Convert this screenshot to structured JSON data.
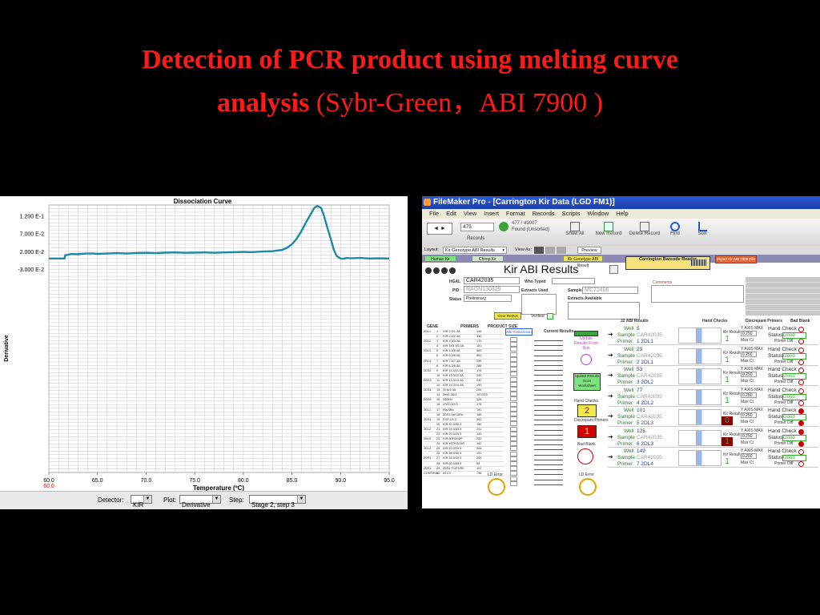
{
  "slide": {
    "title_bold_line1": "Detection of PCR product using melting curve",
    "title_bold_line2": "analysis",
    "title_rest": " (Sybr-Green，ABI 7900 )"
  },
  "chart_data": {
    "type": "line",
    "title": "Dissociation Curve",
    "xlabel": "Temperature (ºC)",
    "ylabel": "Derivative",
    "xlim": [
      60,
      95
    ],
    "ylim": [
      -0.6,
      0.15
    ],
    "x_ticks": [
      "60.0",
      "65.0",
      "70.0",
      "75.0",
      "80.0",
      "85.0",
      "90.0",
      "95.0"
    ],
    "x_tick_min_red": "60.0",
    "y_ticks": [
      "1.200 E-1",
      "7.000 E-2",
      "2.000 E-2",
      "-3.000 E-2"
    ],
    "grid": true,
    "line_color": "#1a8aa6",
    "series": [
      {
        "x": [
          60.0,
          61.6,
          61.7,
          61.8,
          62.0,
          62.3,
          63.0,
          63.5,
          64.0,
          64.5,
          65.0,
          66.0,
          67.0,
          68.0,
          69.0,
          70.0,
          71.0,
          72.0,
          73.0,
          74.0,
          75.0,
          76.0,
          77.0,
          78.0,
          79.0,
          80.0,
          81.0,
          82.0,
          83.0,
          84.0,
          84.5,
          85.0,
          85.5,
          86.0,
          86.5,
          87.0,
          87.3,
          87.6,
          88.0,
          88.3,
          88.6,
          89.0,
          89.3,
          89.6,
          90.0,
          90.3,
          90.6,
          91.0,
          92.0,
          93.0,
          94.0,
          95.0
        ],
        "values": [
          0.0,
          0.0,
          0.0095,
          0.0095,
          0.0105,
          0.0125,
          0.012,
          0.0135,
          0.014,
          0.014,
          0.013,
          0.014,
          0.015,
          0.014,
          0.0155,
          0.016,
          0.015,
          0.0165,
          0.017,
          0.016,
          0.0165,
          0.017,
          0.016,
          0.017,
          0.0175,
          0.0185,
          0.018,
          0.0195,
          0.0205,
          0.024,
          0.03,
          0.04,
          0.056,
          0.078,
          0.104,
          0.128,
          0.142,
          0.147,
          0.142,
          0.12,
          0.09,
          0.055,
          0.025,
          0.007,
          0.0,
          -0.001,
          0.0015,
          0.0005,
          0.0015,
          0.0,
          0.0005,
          0.0
        ]
      }
    ]
  },
  "controls": {
    "detector_label": "Detector:",
    "detector_value": "KIR",
    "plot_label": "Plot:",
    "plot_value": "Derivative",
    "step_label": "Step:",
    "step_value": "Stage 2, step 3"
  },
  "filemaker": {
    "window_title": "FileMaker Pro - [Carrington Kir Data (LGD FM1)]",
    "menu": [
      "File",
      "Edit",
      "View",
      "Insert",
      "Format",
      "Records",
      "Scripts",
      "Window",
      "Help"
    ],
    "record_number": "475",
    "found_line1": "477 / 49007",
    "found_line2": "Found (Unsorted)",
    "records_label": "Records",
    "toolbar_buttons": [
      "Show All",
      "New Record",
      "Delete Record",
      "Find",
      "Sort"
    ],
    "layout_label": "Layout:",
    "layout_value": "Kir Genotype ABI Results",
    "view_as_label": "View As:",
    "preview_label": "Preview",
    "tabs": [
      "Human Kir",
      "Chimp Kir",
      "Kir Genotype ABI Result"
    ],
    "heading": "Kir ABI Results",
    "barcode_button": "Carrington Barcode Reader",
    "import_button": "Import Kir ABI 7900 File",
    "hgal_label": "HGAL",
    "hgal_value": "CAR42035",
    "pid_label": "PID",
    "pid_value": "RAGN130329",
    "status_label": "Status",
    "status_value": "Preliminary",
    "who_typed_label": "Who Typed",
    "extracts_used_label": "Extracts Used",
    "sample_label": "Sample",
    "sample_value": "MC72406",
    "extracts_available_label": "Extracts Available",
    "comments_label": "Comments",
    "clear_button": "Clear ReDos",
    "verified_label": "Verified",
    "gene_headers": [
      "GENE",
      "PRIMERS",
      "PRODUCT SIZE"
    ],
    "abi_conversion": "ABI Conversion",
    "current_results": "Current Results",
    "update_results": "Update Results From Run",
    "update_results_scan": "Update Results Scan Worksheet",
    "results_count": "32 ABI Results",
    "hand_checks_label": "Hand Checks",
    "hand_checks_value": "2",
    "discrepant_primers_label": "Discrepant Primers",
    "discrepant_primers_value": "1",
    "bad_blank_label": "Bad Blank",
    "ld_error": "LD Error",
    "gene_rows": [
      [
        "2DL1",
        "1",
        "KIR 2.5/1.3A",
        "146"
      ],
      [
        "",
        "2",
        "KIR 2.3/2.3A",
        "330"
      ],
      [
        "2DL2",
        "3",
        "KIR 3.3/3.3A",
        "175"
      ],
      [
        "",
        "4",
        "KIR 3X5 3/5.3A",
        "151"
      ],
      [
        "2DL3",
        "5",
        "KIR 5.3/5.3A",
        "550"
      ],
      [
        "",
        "6",
        "KIR 6.3/6.3A",
        "800"
      ],
      [
        "2DL4",
        "7",
        "KIR 7.3/7.3A",
        "254"
      ],
      [
        "",
        "8",
        "KIR 8.3/8.3A",
        "288"
      ],
      [
        "2DS2",
        "9",
        "KIR 11.3/11.3A",
        "175"
      ],
      [
        "",
        "10",
        "KIR 12.3/12.3A",
        "240"
      ],
      [
        "2DS3",
        "11",
        "KIR 13.3/13.3A",
        "240"
      ],
      [
        "",
        "12",
        "KIR 14.3/14.3A",
        "190"
      ],
      [
        "2DS4",
        "13",
        "Sf is/1.0A",
        "204"
      ],
      [
        "",
        "14",
        "Dec1.38/3",
        "197/219"
      ],
      [
        "2DS5",
        "15",
        "130/IM",
        "126"
      ],
      [
        "",
        "16",
        "470C/3/2/3",
        "178"
      ],
      [
        "3DL1",
        "17",
        "Fta/3Ra",
        "191"
      ],
      [
        "",
        "18",
        "3DS1.5a/13Ra",
        "186"
      ],
      [
        "3DS1",
        "19",
        "EX3 1/3.3",
        "300"
      ],
      [
        "",
        "20",
        "KIR 32.3/32.3",
        "180"
      ],
      [
        "3DL2",
        "21",
        "KIR 33.3/33.3",
        "211"
      ],
      [
        "",
        "22",
        "KIR 20.3/20.3",
        "133"
      ],
      [
        "2DL5",
        "23",
        "KIR 80F/2D2P",
        "232"
      ],
      [
        "",
        "24",
        "KIR 46TF/3/11R",
        "182"
      ],
      [
        "3DL3",
        "25",
        "KIR 29.3/29.3",
        "254"
      ],
      [
        "",
        "26",
        "KIR 30.3/30.3",
        "191"
      ],
      [
        "2DP1",
        "27",
        "KIR 33.3/33.3",
        "205"
      ],
      [
        "",
        "28",
        "KIR 69.3/69.3",
        "89"
      ],
      [
        "2DS1",
        "29",
        "2DS1 F1/F2/R0",
        "102"
      ],
      [
        "CONTROL",
        "30",
        "ATL/3",
        "796"
      ]
    ],
    "wells": [
      {
        "well": "5",
        "sample": "CAR42035",
        "primer": "1 2DL1",
        "kir_result": "1"
      },
      {
        "well": "29",
        "sample": "CAR42035",
        "primer": "2 2DL1",
        "kir_result": "1"
      },
      {
        "well": "53",
        "sample": "CAR42035",
        "primer": "3 2DL2",
        "kir_result": "1"
      },
      {
        "well": "77",
        "sample": "CAR42035",
        "primer": "4 2DL2",
        "kir_result": "1"
      },
      {
        "well": "101",
        "sample": "CAR42035",
        "primer": "5 2DL3",
        "kir_result": "0"
      },
      {
        "well": "125",
        "sample": "CAR42035",
        "primer": "6 2DL3",
        "kir_result": "1"
      },
      {
        "well": "149",
        "sample": "CAR42035",
        "primer": "7 2DL4",
        "kir_result": "1"
      }
    ],
    "well_labels": {
      "well": "Well",
      "sample": "Sample",
      "primer": "Primer",
      "kir_result": "Kir Result",
      "ymax": "Y AXIS MAX",
      "ymax_value": "0.250",
      "max_ct": "Max Ct",
      "hand_check": "Hand Check",
      "status": "Status",
      "status_value": "Good",
      "primer_diff": "Primer Diff"
    }
  }
}
